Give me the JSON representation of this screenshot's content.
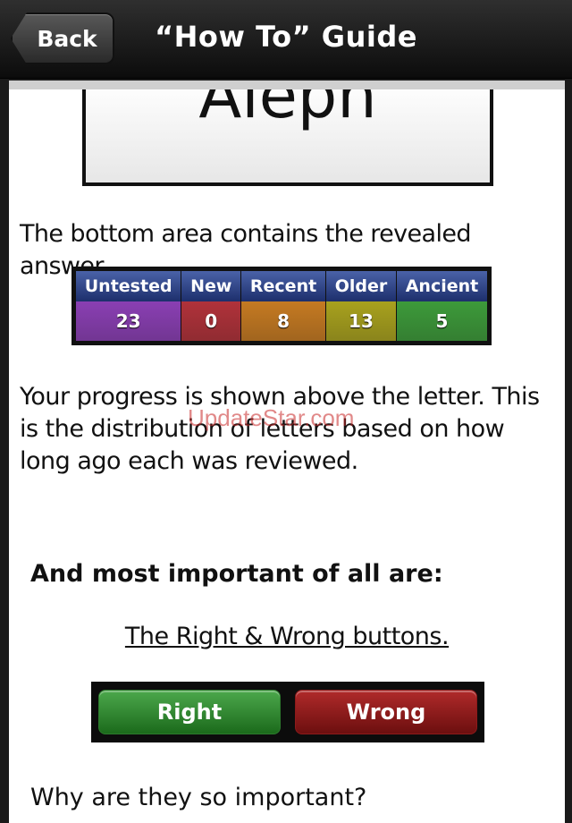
{
  "navbar": {
    "back_label": "Back",
    "title": "“How To” Guide"
  },
  "letter_card": {
    "text": "Aleph"
  },
  "content": {
    "paragraph1": "The bottom area contains the revealed answer.",
    "paragraph2": "Your progress is shown above the letter. This is the distribution of letters based on how long ago each was reviewed.",
    "watermark": "UpdateStar.com",
    "heading": "And most important of all are:",
    "link_text": "The Right & Wrong buttons.",
    "question": "Why are they so important?"
  },
  "progress": {
    "columns": [
      {
        "label": "Untested",
        "value": "23",
        "color": "#8a3fb3"
      },
      {
        "label": "New",
        "value": "0",
        "color": "#b0323a"
      },
      {
        "label": "Recent",
        "value": "8",
        "color": "#c57a22"
      },
      {
        "label": "Older",
        "value": "13",
        "color": "#a8a11e"
      },
      {
        "label": "Ancient",
        "value": "5",
        "color": "#3d9a3a"
      }
    ]
  },
  "buttons": {
    "right_label": "Right",
    "wrong_label": "Wrong"
  }
}
